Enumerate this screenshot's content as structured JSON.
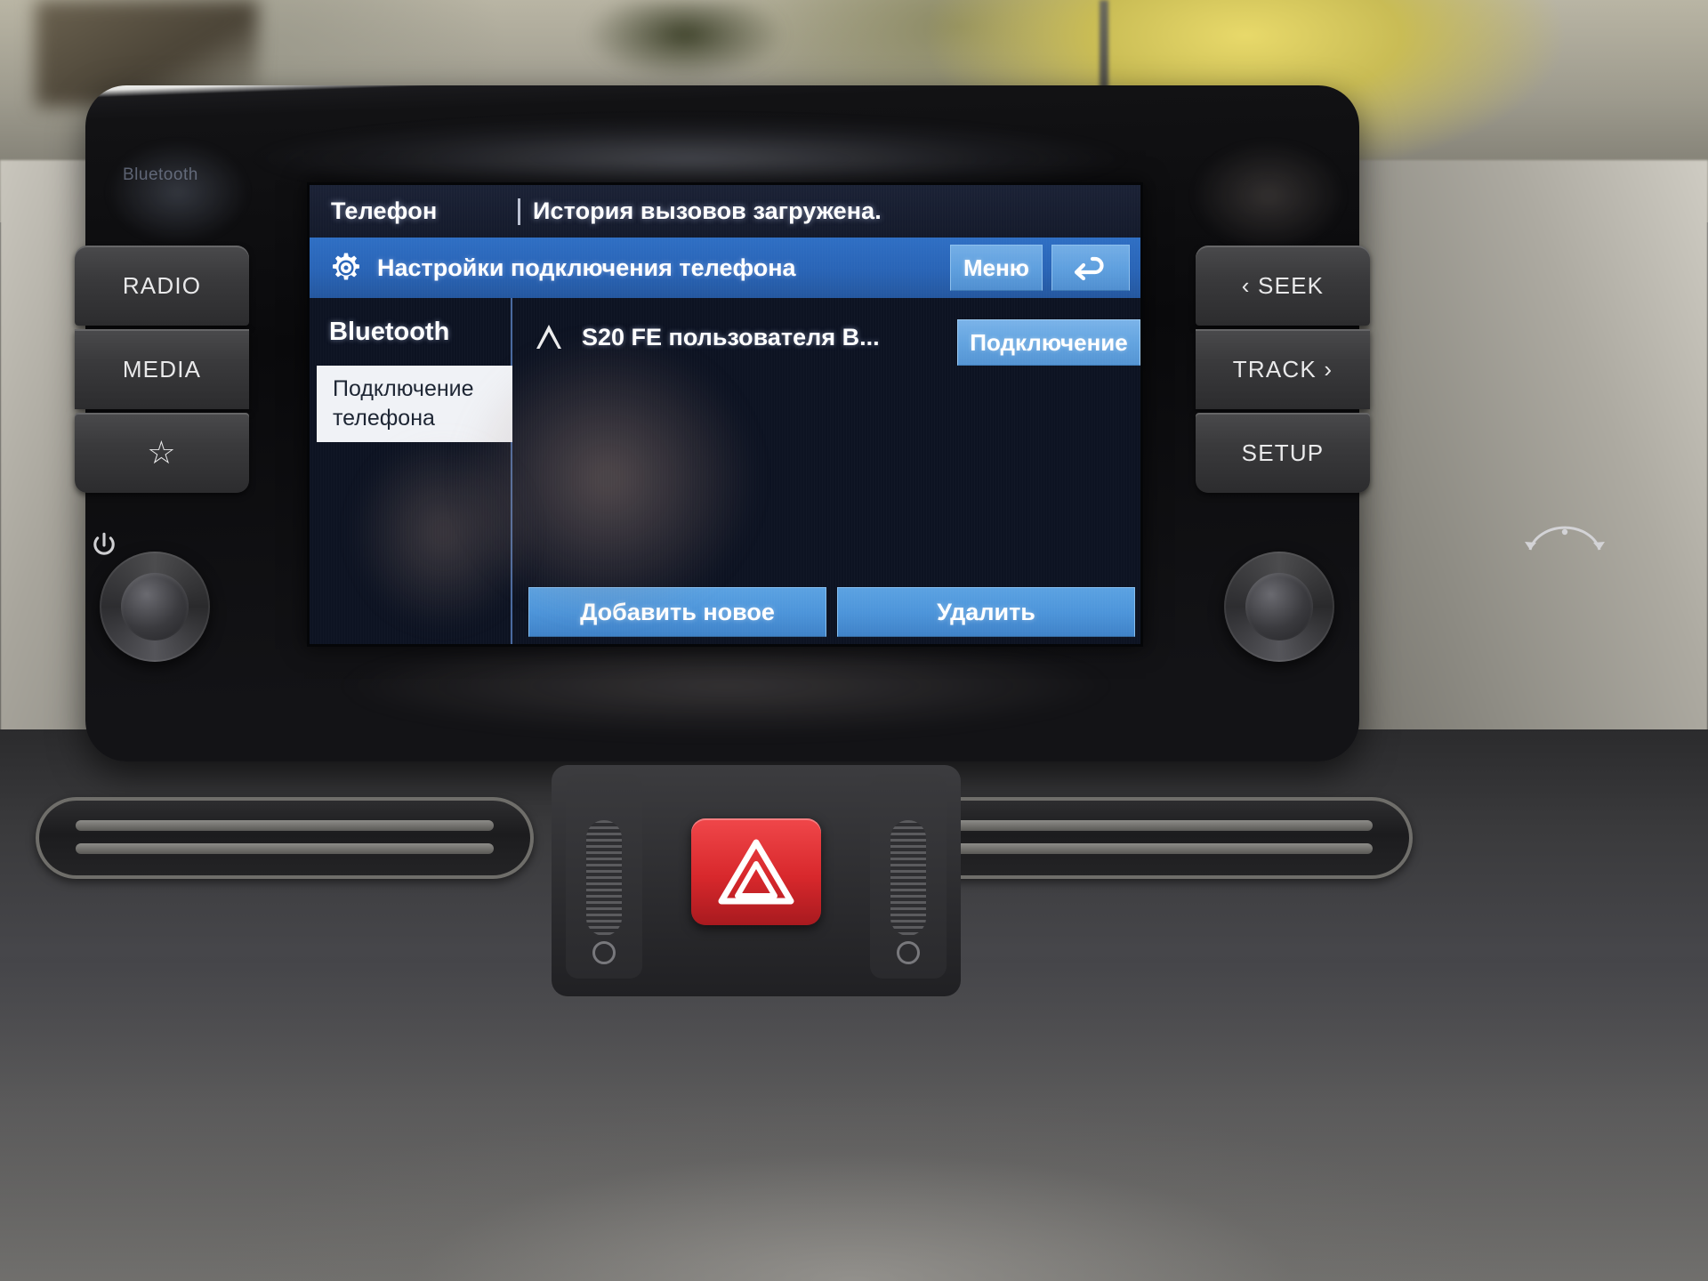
{
  "head_unit": {
    "brand_badge": "Bluetooth",
    "hardware_buttons": {
      "left_column": [
        {
          "name": "radio",
          "label": "RADIO"
        },
        {
          "name": "media",
          "label": "MEDIA"
        },
        {
          "name": "favorites",
          "label": "☆"
        }
      ],
      "right_column": [
        {
          "name": "seek",
          "label": "‹ SEEK"
        },
        {
          "name": "track",
          "label": "TRACK ›"
        },
        {
          "name": "setup",
          "label": "SETUP"
        }
      ],
      "power_knob_icon": "power-icon",
      "tune_knob_icon": "tune-rotate-icon"
    }
  },
  "screen": {
    "titlebar": {
      "app_title": "Телефон",
      "status_message": "История вызовов загружена."
    },
    "settings_bar": {
      "icon": "gear-icon",
      "title": "Настройки подключения телефона",
      "menu_button": "Меню",
      "back_button_icon": "back-arrow-icon"
    },
    "sidebar": {
      "heading": "Bluetooth",
      "items": [
        {
          "label": "Подключение телефона",
          "line1": "Подключение",
          "line2": "телефона",
          "selected": true
        }
      ]
    },
    "device_list": [
      {
        "icon": "android-auto-icon",
        "name": "S20 FE пользователя B...",
        "action_label": "Подключение"
      }
    ],
    "bottom_buttons": [
      {
        "label": "Добавить новое"
      },
      {
        "label": "Удалить"
      }
    ]
  },
  "colors": {
    "accent_blue": "#2f6fc4",
    "button_blue": "#5ba2e2",
    "screen_bg": "#0d1322",
    "sidebar_selected_bg": "#f0f2f6",
    "hazard_red": "#d8282c"
  }
}
